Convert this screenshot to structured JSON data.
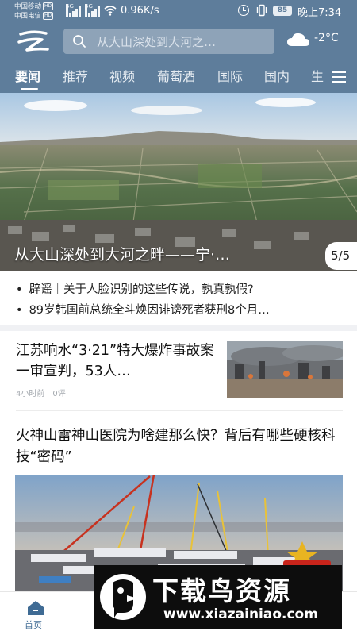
{
  "status_bar": {
    "carrier1": "中国移动",
    "carrier2": "中国电信",
    "hd_badge": "HD",
    "network_badge": "4G",
    "net_speed": "0.96K/s",
    "battery": "85",
    "time": "晚上7:34",
    "icons": [
      "signal-icon",
      "wifi-icon",
      "alarm-icon",
      "vibrate-icon",
      "battery-icon"
    ]
  },
  "header": {
    "search_placeholder": "从大山深处到大河之…",
    "temperature": "-2°C",
    "weather_icon": "cloud-icon",
    "logo_icon": "app-logo-icon"
  },
  "tabs": [
    "要闻",
    "推荐",
    "视频",
    "葡萄酒",
    "国际",
    "国内",
    "生"
  ],
  "active_tab_index": 0,
  "hero": {
    "caption": "从大山深处到大河之畔——宁·…",
    "pager": "5/5"
  },
  "bullets": [
    "辟谣｜关于人脸识别的这些传说，孰真孰假?",
    "89岁韩国前总统全斗焕因诽谤死者获刑8个月…"
  ],
  "news": [
    {
      "title": "江苏响水“3·21”特大爆炸事故案一审宣判，53人…",
      "time": "4小时前",
      "comments": "0评"
    },
    {
      "title": "火神山雷神山医院为啥建那么快？背后有哪些硬核科技“密码”"
    }
  ],
  "bottom_nav": {
    "home_label": "首页"
  },
  "watermark": {
    "title": "下载鸟资源",
    "url": "www.xiazainiao.com"
  },
  "colors": {
    "header_bg": "#5e7d9b",
    "search_bg": "#8ea3b8",
    "home_active": "#3f6b94"
  }
}
